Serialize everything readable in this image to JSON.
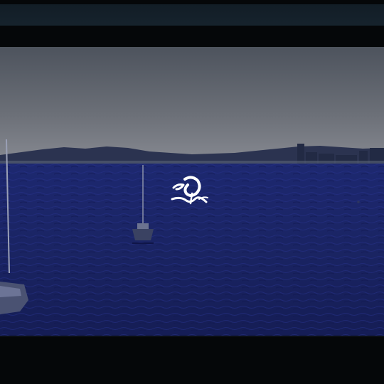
{
  "player": {
    "logo_icon": "brush-script-logo-icon",
    "colors": {
      "sky_top": "#4f5560",
      "sky_bottom": "#7b7f86",
      "sea_top": "#1b2466",
      "sea_bottom": "#161f59",
      "hills": "#2a3350",
      "logo": "#ffffff",
      "letterbox": "#050709"
    }
  }
}
